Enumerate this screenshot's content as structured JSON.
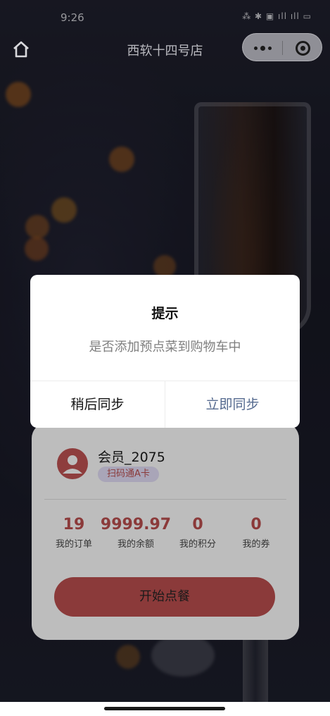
{
  "status_bar": {
    "time": "9:26",
    "icons_text": "⁂ ✱ ▣ ıll ıll ▭"
  },
  "navbar": {
    "title": "西软十四号店",
    "home_icon": "home-icon",
    "more_icon": "more-dots-icon",
    "close_icon": "target-close-icon"
  },
  "dialog": {
    "title": "提示",
    "message": "是否添加预点菜到购物车中",
    "cancel_label": "稍后同步",
    "confirm_label": "立即同步",
    "confirm_color": "#556a8f"
  },
  "member": {
    "name": "会员_2075",
    "tag": "扫码通A卡",
    "avatar_icon": "user-avatar-icon",
    "stats": [
      {
        "value": "19",
        "label": "我的订单"
      },
      {
        "value": "9999.97",
        "label": "我的余额"
      },
      {
        "value": "0",
        "label": "我的积分"
      },
      {
        "value": "0",
        "label": "我的券"
      }
    ],
    "order_button_label": "开始点餐",
    "accent_color": "#8b3a3a"
  }
}
